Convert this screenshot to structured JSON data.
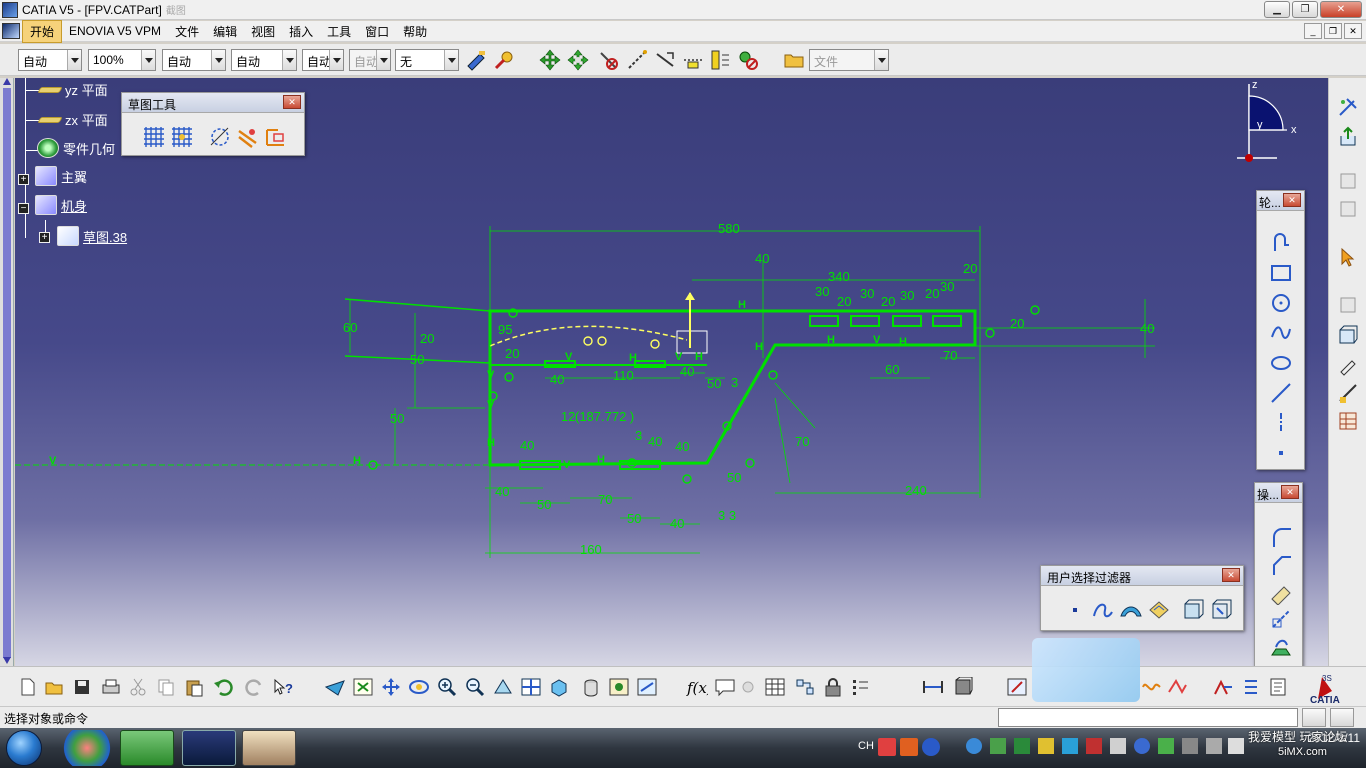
{
  "window": {
    "title": "CATIA V5 - [FPV.CATPart]",
    "title_faded": "截图",
    "minimize_glyph": "▁",
    "restore_glyph": "❐",
    "close_glyph": "✕"
  },
  "menu": {
    "items": [
      "开始",
      "ENOVIA V5 VPM",
      "文件",
      "编辑",
      "视图",
      "插入",
      "工具",
      "窗口",
      "帮助"
    ],
    "mdi_minimize": "_",
    "mdi_restore": "❐",
    "mdi_close": "✕"
  },
  "toolbar": {
    "combo_color": "自动",
    "combo_zoom": "100%",
    "combo_linetype": "自动",
    "combo_thickness": "自动",
    "combo_layer1": "自动",
    "combo_layer2": "自动",
    "combo_layer_none": "无",
    "combo_file": "文件"
  },
  "tree": {
    "items": [
      {
        "label": "yz 平面",
        "icon": "plane-icon"
      },
      {
        "label": "zx 平面",
        "icon": "plane-icon"
      },
      {
        "label": "零件几何",
        "icon": "gear-icon"
      },
      {
        "label": "主翼",
        "icon": "body-icon"
      },
      {
        "label": "机身",
        "icon": "body-icon"
      },
      {
        "label": "草图.38",
        "icon": "sketch-icon"
      }
    ],
    "expand_plus": "+",
    "expand_minus": "−"
  },
  "sketch_tools_toolbar": {
    "title": "草图工具",
    "close_glyph": "✕"
  },
  "profile_toolbar": {
    "title": "轮...",
    "close_glyph": "✕"
  },
  "operation_toolbar": {
    "title": "操...",
    "close_glyph": "✕"
  },
  "filter_toolbar": {
    "title": "用户选择过滤器",
    "close_glyph": "✕"
  },
  "compass": {
    "x_label": "x",
    "y_label": "y",
    "z_label": "z"
  },
  "sketch": {
    "dims": {
      "d580": "580",
      "d40a": "40",
      "d340": "340",
      "d30a": "30",
      "d20a": "20",
      "d30b": "30",
      "d20b": "20",
      "d30c": "30",
      "d20c": "20",
      "d30d": "30",
      "d20d": "20",
      "d60": "60",
      "d20e": "20",
      "d95": "95",
      "d20f": "20",
      "d40b": "40",
      "d20g": "20",
      "d50a": "50",
      "d40c": "40",
      "d110": "110",
      "d40d": "40",
      "d50b": "50",
      "d3": "3",
      "d60b": "60",
      "d70a": "70",
      "d50c": "50",
      "d12": "12",
      "d187": "(187.772 )",
      "d3b": "3",
      "d40e": "40",
      "d40f": "40",
      "d40g": "40",
      "d70b": "70",
      "d40h": "40",
      "d50d": "50",
      "d70c": "70",
      "d50e": "50",
      "d40i": "40",
      "d33": "3  3",
      "d50f": "50",
      "d240": "240",
      "d160": "160",
      "d50g": "50"
    },
    "marks": {
      "H": "H",
      "V": "V"
    }
  },
  "status": {
    "prompt": "选择对象或命令"
  },
  "taskbar": {
    "lang": "CH",
    "clock_time": "",
    "clock_date": "2012/3/11"
  },
  "watermark": {
    "line1": "我爱模型 玩家论坛",
    "line2": "5iMX.com"
  },
  "colors": {
    "viewport_top": "#3a3d7a",
    "sketch_green": "#00e000",
    "constraint_yellow": "#ffff60",
    "menu_active": "#f6d27a"
  }
}
